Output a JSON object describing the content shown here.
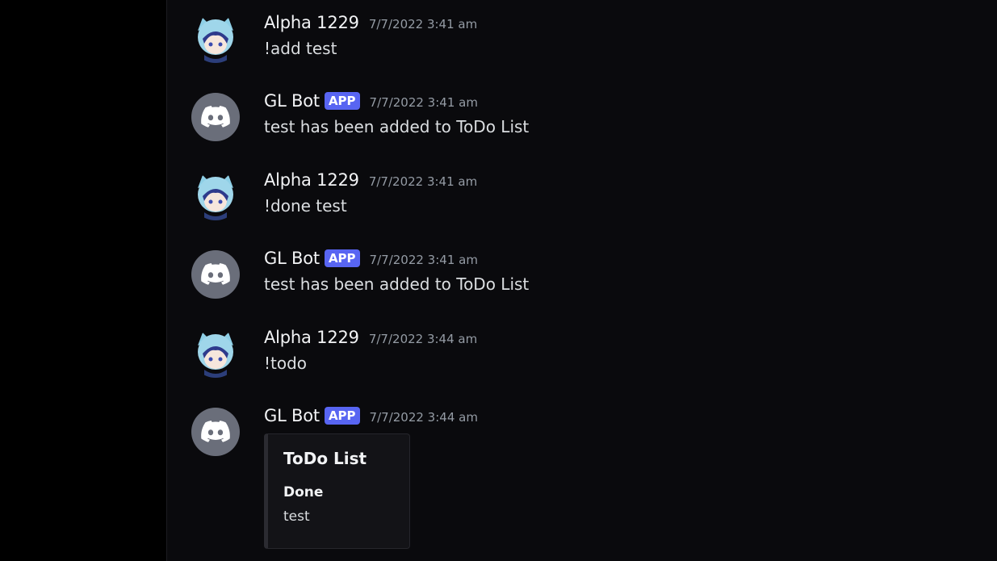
{
  "messages": [
    {
      "author": "Alpha 1229",
      "timestamp": "7/7/2022 3:41 am",
      "content": "!add test"
    },
    {
      "author": "GL Bot",
      "badge": "APP",
      "timestamp": "7/7/2022 3:41 am",
      "content": "test has been added to ToDo List"
    },
    {
      "author": "Alpha 1229",
      "timestamp": "7/7/2022 3:41 am",
      "content": "!done test"
    },
    {
      "author": "GL Bot",
      "badge": "APP",
      "timestamp": "7/7/2022 3:41 am",
      "content": "test has been added to ToDo List"
    },
    {
      "author": "Alpha 1229",
      "timestamp": "7/7/2022 3:44 am",
      "content": "!todo"
    },
    {
      "author": "GL Bot",
      "badge": "APP",
      "timestamp": "7/7/2022 3:44 am",
      "embed": {
        "title": "ToDo List",
        "field_name": "Done",
        "field_value": "test"
      }
    }
  ],
  "icons": {
    "bot_avatar": "discord-logo-icon",
    "user_avatar": "anime-character-avatar-icon"
  },
  "colors": {
    "badge": "#5865f2",
    "background": "#0a0a0d",
    "sidebar": "#000000"
  }
}
